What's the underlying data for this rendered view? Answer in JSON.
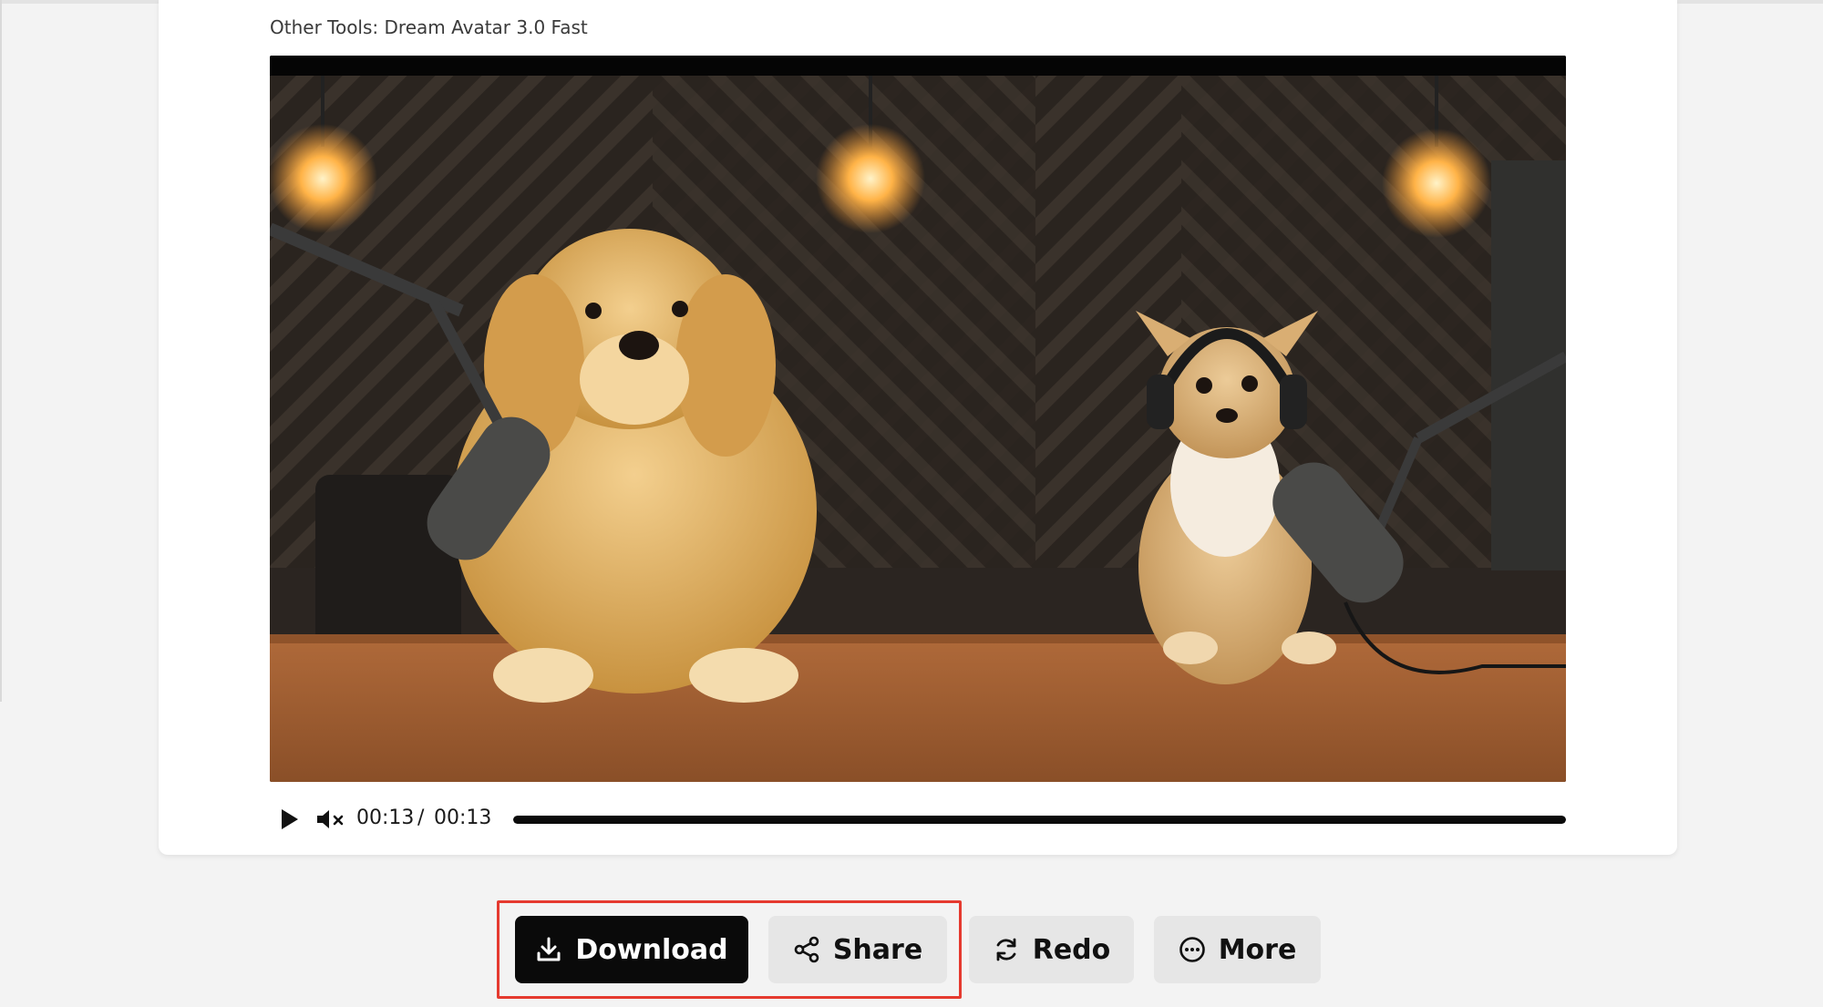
{
  "tool": {
    "label": "Other Tools: Dream Avatar 3.0 Fast"
  },
  "player": {
    "current_time": "00:13",
    "separator": "/",
    "total_time": "00:13",
    "progress": 1.0,
    "muted": true,
    "play_icon": "play-icon",
    "mute_icon": "volume-muted-icon"
  },
  "actions": {
    "download_label": "Download",
    "share_label": "Share",
    "redo_label": "Redo",
    "more_label": "More",
    "download_icon": "download-icon",
    "share_icon": "share-icon",
    "redo_icon": "refresh-icon",
    "more_icon": "more-dots-icon"
  },
  "colors": {
    "primary_button": "#0a0a0a",
    "secondary_button": "#e6e6e6",
    "highlight": "#e53a2f",
    "progress": "#0b0b0b"
  }
}
